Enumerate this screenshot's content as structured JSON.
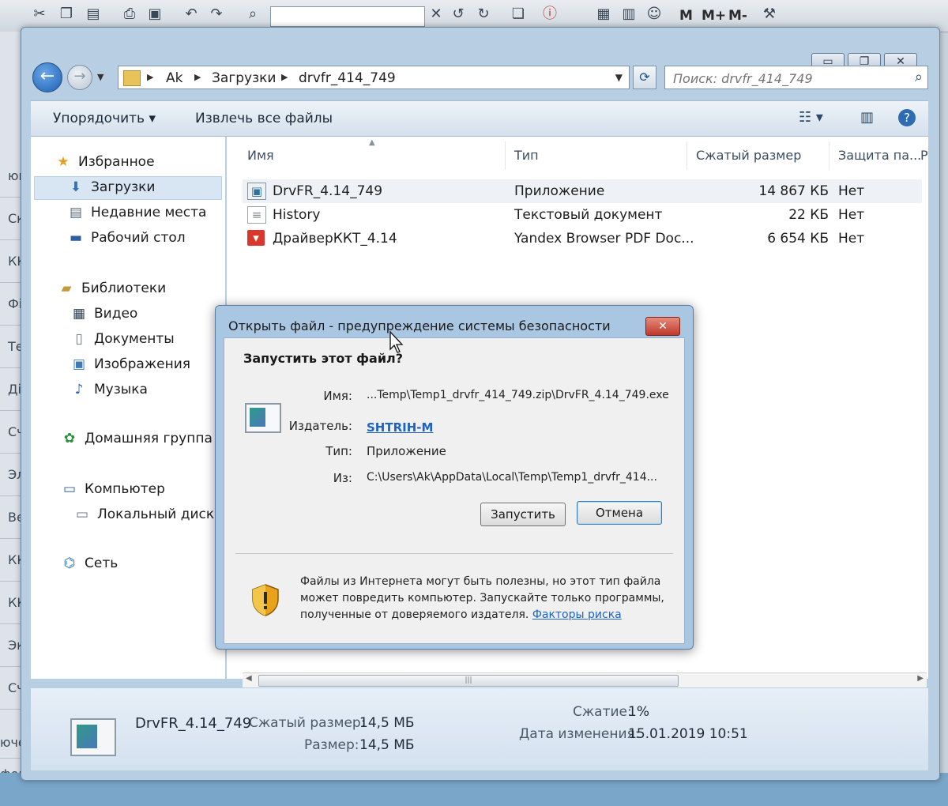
{
  "background_app": {
    "search_value": "",
    "memory_buttons": [
      "M",
      "M+",
      "M-"
    ],
    "left_rows": [
      "ющ",
      "Ск",
      "КК",
      "Фі",
      "Те",
      "Ді",
      "Сч",
      "Эл",
      "Ве",
      "КК",
      "КК",
      "Эк",
      "Сч",
      "ючен",
      "форм"
    ]
  },
  "explorer": {
    "breadcrumbs": [
      "Ak",
      "Загрузки",
      "drvfr_414_749"
    ],
    "search_placeholder": "Поиск: drvfr_414_749",
    "commands": {
      "organize": "Упорядочить",
      "extract_all": "Извлечь все файлы"
    },
    "nav": {
      "favorites": "Избранное",
      "downloads": "Загрузки",
      "recent": "Недавние места",
      "desktop": "Рабочий стол",
      "libraries": "Библиотеки",
      "video": "Видео",
      "documents": "Документы",
      "images": "Изображения",
      "music": "Музыка",
      "homegroup": "Домашняя группа",
      "computer": "Компьютер",
      "local_disk": "Локальный диск (",
      "network": "Сеть"
    },
    "columns": {
      "name": "Имя",
      "type": "Тип",
      "compressed_size": "Сжатый размер",
      "protection": "Защита па...",
      "extra": "Р"
    },
    "files": [
      {
        "name": "DrvFR_4.14_749",
        "type": "Приложение",
        "size": "14 867 КБ",
        "protected": "Нет"
      },
      {
        "name": "History",
        "type": "Текстовый документ",
        "size": "22 КБ",
        "protected": "Нет"
      },
      {
        "name": "ДрайверККТ_4.14",
        "type": "Yandex Browser PDF Doc...",
        "size": "6 654 КБ",
        "protected": "Нет"
      }
    ],
    "details": {
      "name": "DrvFR_4.14_749",
      "compressed_label": "Сжатый размер:",
      "compressed_value": "14,5 МБ",
      "size_label": "Размер:",
      "size_value": "14,5 МБ",
      "ratio_label": "Сжатие:",
      "ratio_value": "1%",
      "modified_label": "Дата изменения:",
      "modified_value": "15.01.2019 10:51"
    }
  },
  "dialog": {
    "title": "Открыть файл - предупреждение системы безопасности",
    "question": "Запустить этот файл?",
    "name_label": "Имя:",
    "name_value": "...Temp\\Temp1_drvfr_414_749.zip\\DrvFR_4.14_749.exe",
    "publisher_label": "Издатель:",
    "publisher_value": "SHTRIH-M",
    "type_label": "Тип:",
    "type_value": "Приложение",
    "from_label": "Из:",
    "from_value": "C:\\Users\\Ak\\AppData\\Local\\Temp\\Temp1_drvfr_414...",
    "run_button": "Запустить",
    "cancel_button": "Отмена",
    "warning_text": "Файлы из Интернета могут быть полезны, но этот тип файла может повредить компьютер. Запускайте только программы, полученные от доверяемого издателя.",
    "risk_link": "Факторы риска"
  }
}
